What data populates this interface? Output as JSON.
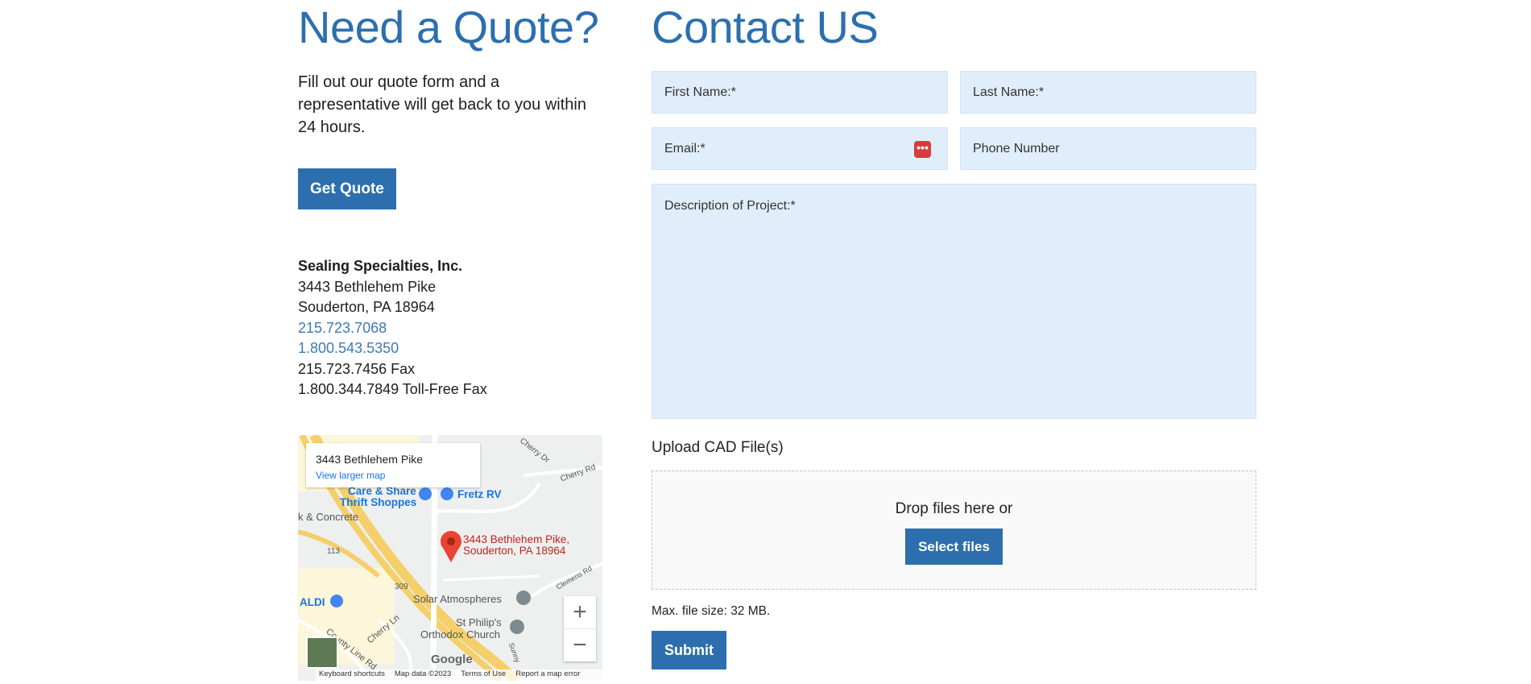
{
  "quote": {
    "heading": "Need a Quote?",
    "intro": "Fill out our quote form and a representative will get back to you within 24 hours.",
    "button_label": "Get Quote"
  },
  "company": {
    "name": "Sealing Specialties, Inc.",
    "address_line1": "3443 Bethlehem Pike",
    "address_line2": "Souderton, PA 18964",
    "phone1": "215.723.7068",
    "phone2": "1.800.543.5350",
    "fax1": "215.723.7456 Fax",
    "fax2": "1.800.344.7849 Toll-Free Fax"
  },
  "map": {
    "card_title": "3443 Bethlehem Pike",
    "card_link": "View larger map",
    "pin_label_line1": "3443 Bethlehem Pike,",
    "pin_label_line2": "Souderton, PA 18964",
    "labels": {
      "cherry_dr": "Cherry Dr",
      "cherry_rd": "Cherry Rd",
      "care_share": "Care & Share",
      "thrift": "Thrift Shoppes",
      "fretz": "Fretz RV",
      "concrete": "k & Concrete",
      "route_113": "113",
      "route_309": "309",
      "solar": "Solar Atmospheres",
      "aldi": "ALDI",
      "st_philips": "St Philip's",
      "orthodox": "Orthodox Church",
      "county_line": "County Line Rd",
      "cherry_ln": "Cherry Ln",
      "clemens": "Clemens Rd",
      "sunny": "Sunny"
    },
    "zoom_in": "+",
    "zoom_out": "−",
    "google": "Google",
    "footer": {
      "shortcuts": "Keyboard shortcuts",
      "data": "Map data ©2023",
      "terms": "Terms of Use",
      "report": "Report a map error"
    }
  },
  "contact": {
    "heading": "Contact US",
    "first_name": "First Name:*",
    "last_name": "Last Name:*",
    "email": "Email:*",
    "phone": "Phone Number",
    "description": "Description of Project:*",
    "password_icon": "•••",
    "upload_label": "Upload CAD File(s)",
    "drop_text": "Drop files here or",
    "select_files": "Select files",
    "max_size": "Max. file size: 32 MB.",
    "submit": "Submit"
  },
  "colors": {
    "accent": "#2d6fae",
    "field_bg": "#e0edfb",
    "link": "#3d7ab8"
  }
}
